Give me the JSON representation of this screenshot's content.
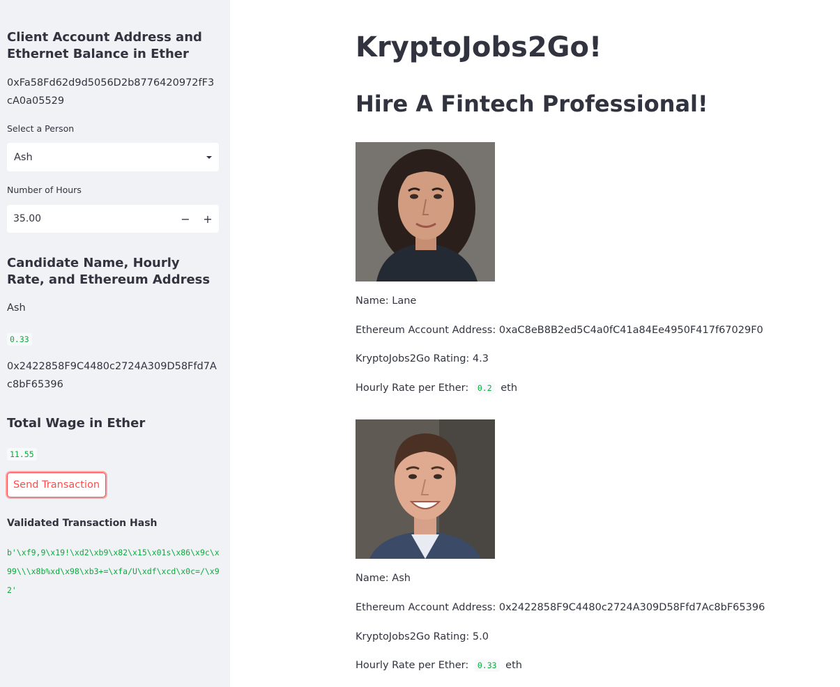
{
  "sidebar": {
    "account_heading": "Client Account Address and Ethernet Balance in Ether",
    "account_address": "0xFa58Fd62d9d5056D2b8776420972fF3cA0a05529",
    "select_label": "Select a Person",
    "select_value": "Ash",
    "hours_label": "Number of Hours",
    "hours_value": "35.00",
    "candidate_heading": "Candidate Name, Hourly Rate, and Ethereum Address",
    "candidate_name": "Ash",
    "candidate_rate": "0.33",
    "candidate_address": "0x2422858F9C4480c2724A309D58Ffd7Ac8bF65396",
    "wage_heading": "Total Wage in Ether",
    "wage_value": "11.55",
    "send_button": "Send Transaction",
    "hash_label": "Validated Transaction Hash",
    "hash_value": "b'\\xf9,9\\x19!\\xd2\\xb9\\x82\\x15\\x01s\\x86\\x9c\\x99\\\\\\x8b%xd\\x98\\xb3+=\\xfa/U\\xdf\\xcd\\x0c=/\\x92'"
  },
  "main": {
    "title": "KryptoJobs2Go!",
    "subtitle": "Hire A Fintech Professional!",
    "candidates": [
      {
        "name": "Name: Lane",
        "address": "Ethereum Account Address: 0xaC8eB8B2ed5C4a0fC41a84Ee4950F417f67029F0",
        "rating": "KryptoJobs2Go Rating: 4.3",
        "rate_prefix": "Hourly Rate per Ether:",
        "rate": "0.2",
        "rate_unit": "eth"
      },
      {
        "name": "Name: Ash",
        "address": "Ethereum Account Address: 0x2422858F9C4480c2724A309D58Ffd7Ac8bF65396",
        "rating": "KryptoJobs2Go Rating: 5.0",
        "rate_prefix": "Hourly Rate per Ether:",
        "rate": "0.33",
        "rate_unit": "eth"
      }
    ]
  },
  "icons": {
    "select_caret": "chevron-down-icon",
    "minus": "minus-icon",
    "plus": "plus-icon"
  },
  "colors": {
    "accent": "#ff4b4b",
    "code_text": "#09ab3b",
    "sidebar_bg": "#f0f2f6",
    "text": "#31333f"
  }
}
